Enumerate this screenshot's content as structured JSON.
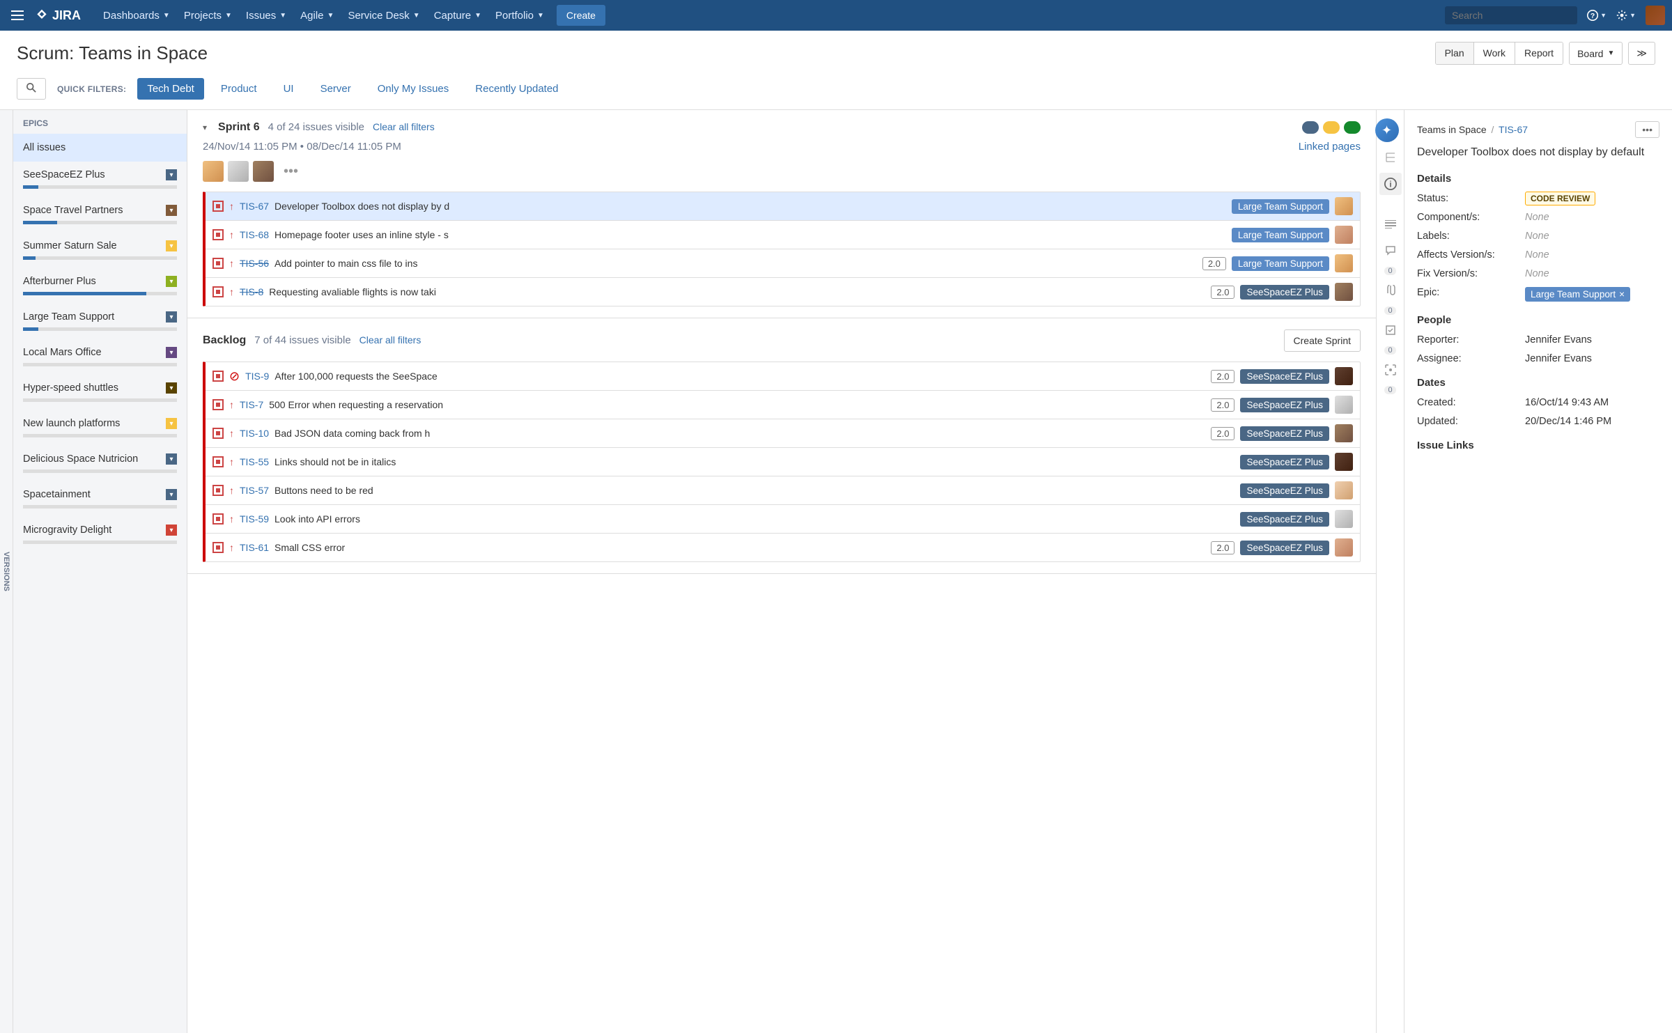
{
  "topnav": {
    "logo": "JIRA",
    "items": [
      "Dashboards",
      "Projects",
      "Issues",
      "Agile",
      "Service Desk",
      "Capture",
      "Portfolio"
    ],
    "create": "Create",
    "search_placeholder": "Search"
  },
  "header": {
    "title": "Scrum: Teams in Space",
    "view_buttons": [
      "Plan",
      "Work",
      "Report"
    ],
    "board_btn": "Board",
    "expand_glyph": "≫"
  },
  "filters": {
    "label": "QUICK FILTERS:",
    "items": [
      "Tech Debt",
      "Product",
      "UI",
      "Server",
      "Only My Issues",
      "Recently Updated"
    ]
  },
  "versions_tab": "VERSIONS",
  "epics": {
    "header": "EPICS",
    "all": "All issues",
    "items": [
      {
        "name": "SeeSpaceEZ Plus",
        "color": "#4a6785",
        "progress": 10
      },
      {
        "name": "Space Travel Partners",
        "color": "#815b3a",
        "progress": 22
      },
      {
        "name": "Summer Saturn Sale",
        "color": "#f6c342",
        "progress": 8
      },
      {
        "name": "Afterburner Plus",
        "color": "#8eb021",
        "progress": 80
      },
      {
        "name": "Large Team Support",
        "color": "#4a6785",
        "progress": 10
      },
      {
        "name": "Local Mars Office",
        "color": "#654982",
        "progress": 0
      },
      {
        "name": "Hyper-speed shuttles",
        "color": "#594300",
        "progress": 0
      },
      {
        "name": "New launch platforms",
        "color": "#f6c342",
        "progress": 0
      },
      {
        "name": "Delicious Space Nutricion",
        "color": "#4a6785",
        "progress": 0
      },
      {
        "name": "Spacetainment",
        "color": "#4a6785",
        "progress": 0
      },
      {
        "name": "Microgravity Delight",
        "color": "#d04437",
        "progress": 0
      }
    ]
  },
  "sprint": {
    "name": "Sprint 6",
    "count": "4 of 24 issues visible",
    "clear": "Clear all filters",
    "dates": "24/Nov/14 11:05 PM  •  08/Dec/14 11:05 PM",
    "linked": "Linked pages",
    "dots": [
      "#4a6785",
      "#f6c342",
      "#14892c"
    ],
    "issues": [
      {
        "key": "TIS-67",
        "summary": "Developer Toolbox does not display by d",
        "epic": "Large Team Support",
        "epic_cls": "blue",
        "done": false,
        "selected": true,
        "av": "av1"
      },
      {
        "key": "TIS-68",
        "summary": "Homepage footer uses an inline style - s",
        "epic": "Large Team Support",
        "epic_cls": "blue",
        "done": false,
        "av": "av4"
      },
      {
        "key": "TIS-56",
        "summary": "Add pointer to main css file to ins",
        "version": "2.0",
        "epic": "Large Team Support",
        "epic_cls": "blue",
        "done": true,
        "av": "av1"
      },
      {
        "key": "TIS-8",
        "summary": "Requesting avaliable flights is now taki",
        "version": "2.0",
        "epic": "SeeSpaceEZ Plus",
        "epic_cls": "",
        "done": true,
        "av": "av3"
      }
    ]
  },
  "backlog": {
    "name": "Backlog",
    "count": "7 of 44 issues visible",
    "clear": "Clear all filters",
    "create_sprint": "Create Sprint",
    "issues": [
      {
        "key": "TIS-9",
        "summary": "After 100,000 requests the SeeSpace",
        "version": "2.0",
        "epic": "SeeSpaceEZ Plus",
        "blocker": true,
        "av": "av5"
      },
      {
        "key": "TIS-7",
        "summary": "500 Error when requesting a reservation",
        "version": "2.0",
        "epic": "SeeSpaceEZ Plus",
        "av": "av2"
      },
      {
        "key": "TIS-10",
        "summary": "Bad JSON data coming back from h",
        "version": "2.0",
        "epic": "SeeSpaceEZ Plus",
        "av": "av3"
      },
      {
        "key": "TIS-55",
        "summary": "Links should not be in italics",
        "epic": "SeeSpaceEZ Plus",
        "av": "av5"
      },
      {
        "key": "TIS-57",
        "summary": "Buttons need to be red",
        "epic": "SeeSpaceEZ Plus",
        "av": "av6"
      },
      {
        "key": "TIS-59",
        "summary": "Look into API errors",
        "epic": "SeeSpaceEZ Plus",
        "av": "av2"
      },
      {
        "key": "TIS-61",
        "summary": "Small CSS error",
        "version": "2.0",
        "epic": "SeeSpaceEZ Plus",
        "av": "av4"
      }
    ]
  },
  "rail": {
    "counts": {
      "comments": "0",
      "attach": "0",
      "worklog": "0",
      "capture": "0"
    }
  },
  "detail": {
    "project": "Teams in Space",
    "sep": "/",
    "key": "TIS-67",
    "title": "Developer Toolbox does not display by default",
    "sections": {
      "details": "Details",
      "people": "People",
      "dates": "Dates",
      "links": "Issue Links"
    },
    "fields": {
      "status_l": "Status:",
      "status_v": "CODE REVIEW",
      "components_l": "Component/s:",
      "components_v": "None",
      "labels_l": "Labels:",
      "labels_v": "None",
      "affects_l": "Affects Version/s:",
      "affects_v": "None",
      "fix_l": "Fix Version/s:",
      "fix_v": "None",
      "epic_l": "Epic:",
      "epic_v": "Large Team Support",
      "reporter_l": "Reporter:",
      "reporter_v": "Jennifer Evans",
      "assignee_l": "Assignee:",
      "assignee_v": "Jennifer Evans",
      "created_l": "Created:",
      "created_v": "16/Oct/14 9:43 AM",
      "updated_l": "Updated:",
      "updated_v": "20/Dec/14 1:46 PM"
    }
  }
}
